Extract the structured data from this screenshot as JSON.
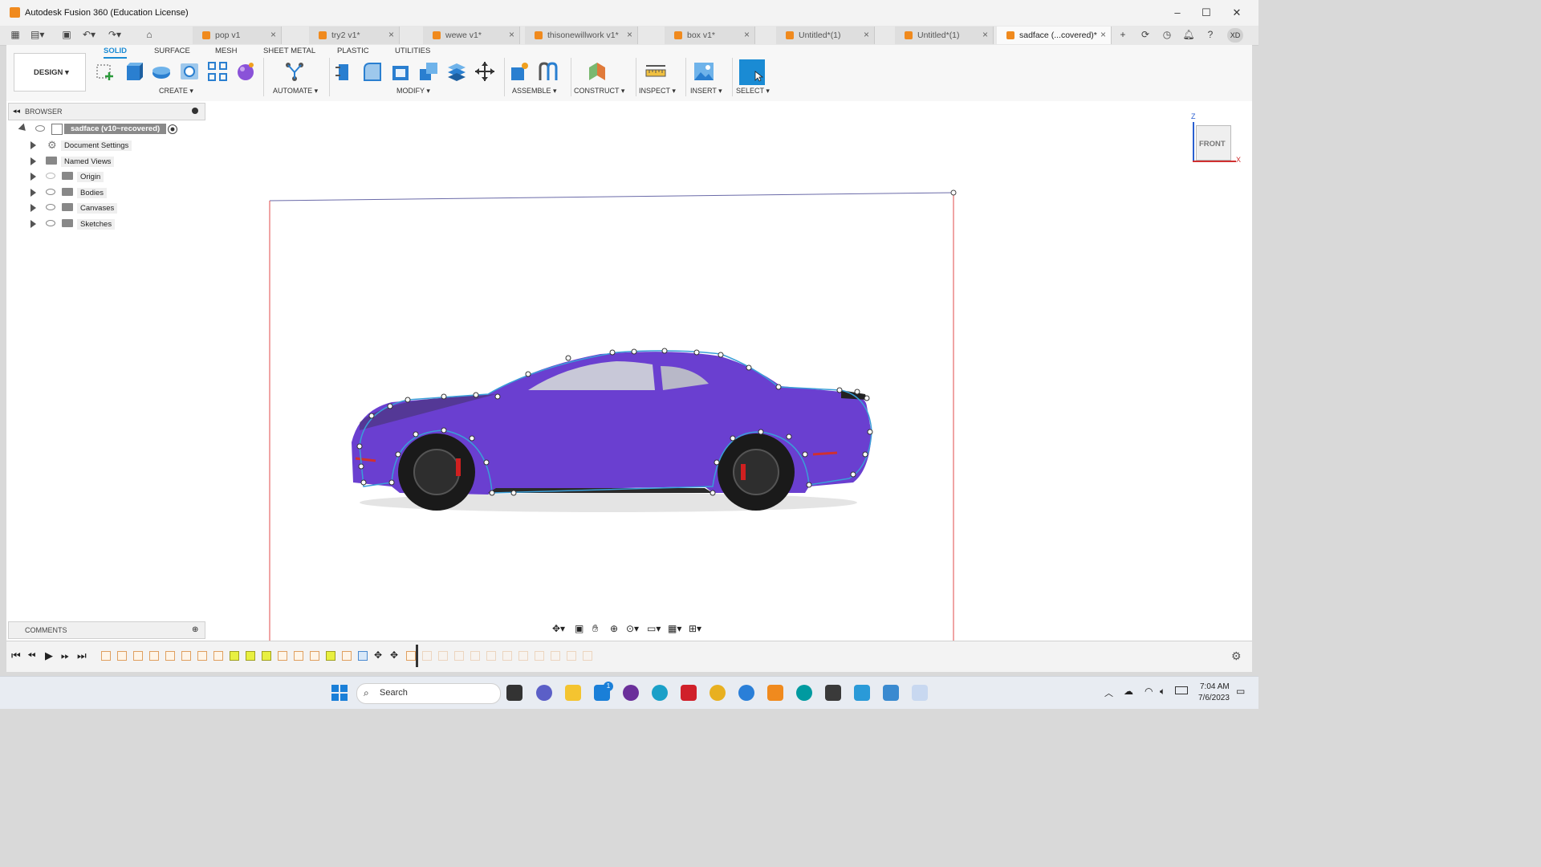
{
  "window": {
    "title": "Autodesk Fusion 360 (Education License)"
  },
  "tabs": [
    {
      "label": "pop v1"
    },
    {
      "label": "try2 v1*"
    },
    {
      "label": "wewe v1*"
    },
    {
      "label": "thisonewillwork v1*"
    },
    {
      "label": "box v1*"
    },
    {
      "label": "Untitled*(1)"
    },
    {
      "label": "Untitled*(1)"
    },
    {
      "label": "sadface (...covered)*"
    }
  ],
  "user_initials": "XD",
  "toolbar": {
    "workspace": "DESIGN ▾",
    "workspace_tabs": [
      "SOLID",
      "SURFACE",
      "MESH",
      "SHEET METAL",
      "PLASTIC",
      "UTILITIES"
    ],
    "groups": [
      "CREATE ▾",
      "AUTOMATE ▾",
      "MODIFY ▾",
      "ASSEMBLE ▾",
      "CONSTRUCT ▾",
      "INSPECT ▾",
      "INSERT ▾",
      "SELECT ▾"
    ]
  },
  "browser": {
    "title": "BROWSER",
    "root": "sadface (v10~recovered)",
    "items": [
      "Document Settings",
      "Named Views",
      "Origin",
      "Bodies",
      "Canvases",
      "Sketches"
    ]
  },
  "comments": {
    "title": "COMMENTS"
  },
  "viewcube": {
    "face": "FRONT",
    "x_axis": "X",
    "z_axis": "Z"
  },
  "taskbar": {
    "search_placeholder": "Search",
    "time": "7:04 AM",
    "date": "7/6/2023",
    "badge": "1"
  },
  "colors": {
    "accent": "#1a8bd4",
    "fusion_orange": "#f08a1e",
    "car_purple": "#6a3fd0",
    "sketch_line": "#3a9fd8",
    "profile_red": "#e04848"
  }
}
